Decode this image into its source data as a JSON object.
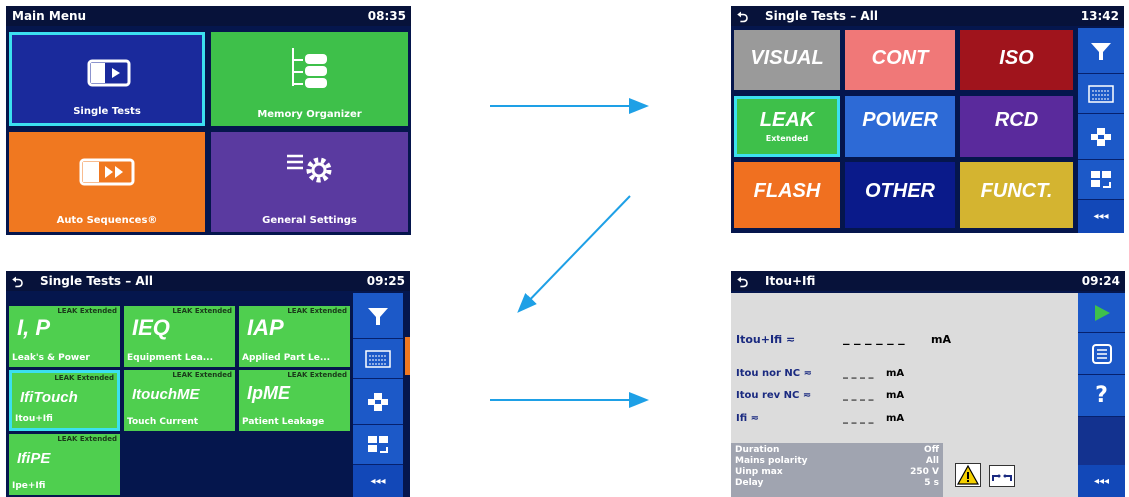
{
  "screen1": {
    "title": "Main Menu",
    "time": "08:35",
    "tiles": [
      {
        "label": "Single Tests",
        "color": "#1a2a9c",
        "icon": "single-tests-icon"
      },
      {
        "label": "Memory Organizer",
        "color": "#3ec04a",
        "icon": "memory-tree-icon"
      },
      {
        "label": "Auto Sequences®",
        "color": "#f07820",
        "icon": "auto-sequence-icon"
      },
      {
        "label": "General Settings",
        "color": "#5a3aa0",
        "icon": "settings-gear-icon"
      }
    ]
  },
  "screen2": {
    "title": "Single Tests – All",
    "time": "13:42",
    "tiles": [
      {
        "label": "VISUAL",
        "sub": "",
        "color": "#9a9a9a"
      },
      {
        "label": "CONT",
        "sub": "",
        "color": "#f07878"
      },
      {
        "label": "ISO",
        "sub": "",
        "color": "#a0141c"
      },
      {
        "label": "LEAK",
        "sub": "Extended",
        "color": "#3ec04a"
      },
      {
        "label": "POWER",
        "sub": "",
        "color": "#2d6ad6"
      },
      {
        "label": "RCD",
        "sub": "",
        "color": "#5a2a9c"
      },
      {
        "label": "FLASH",
        "sub": "",
        "color": "#f07020"
      },
      {
        "label": "OTHER",
        "sub": "",
        "color": "#0a1a8a"
      },
      {
        "label": "FUNCT.",
        "sub": "",
        "color": "#d4b430"
      }
    ],
    "sidebar": [
      "filter-icon",
      "keyboard-icon",
      "move-icon",
      "swap-icon",
      "◂◂◂"
    ]
  },
  "screen3": {
    "title": "Single Tests – All",
    "time": "09:25",
    "tiles": [
      {
        "top": "LEAK Extended",
        "symbol": "I, P",
        "sub": "Leak's & Power"
      },
      {
        "top": "LEAK Extended",
        "symbol": "IEQ",
        "sub": "Equipment Lea..."
      },
      {
        "top": "LEAK Extended",
        "symbol": "IAP",
        "sub": "Applied Part Le..."
      },
      {
        "top": "LEAK Extended",
        "symbol": "IfiTouch",
        "sub": "Itou+Ifi"
      },
      {
        "top": "LEAK Extended",
        "symbol": "ItouchME",
        "sub": "Touch Current"
      },
      {
        "top": "LEAK Extended",
        "symbol": "IpME",
        "sub": "Patient Leakage"
      },
      {
        "top": "LEAK Extended",
        "symbol": "IfiPE",
        "sub": "Ipe+Ifi"
      }
    ],
    "sidebar_more": "◂◂◂"
  },
  "screen4": {
    "title": "Itou+Ifi",
    "time": "09:24",
    "results": [
      {
        "label": "Itou+Ifi ≂",
        "value": "_ _ _ _ _ _",
        "unit": "mA"
      },
      {
        "label": "Itou nor NC ≂",
        "value": "_ _ _ _",
        "unit": "mA"
      },
      {
        "label": "Itou rev NC ≂",
        "value": "_ _ _ _",
        "unit": "mA"
      },
      {
        "label": "Ifi ≂",
        "value": "_ _ _ _",
        "unit": "mA"
      }
    ],
    "params": [
      {
        "name": "Duration",
        "value": "Off"
      },
      {
        "name": "Mains polarity",
        "value": "All"
      },
      {
        "name": "Uinp max",
        "value": "250 V"
      },
      {
        "name": "Delay",
        "value": "5 s"
      }
    ],
    "sidebar": {
      "help": "?",
      "more": "◂◂◂"
    }
  },
  "colors": {
    "accent": "#3ce0f0",
    "arrow": "#1ea0e6",
    "leak_green": "#4fcf4f"
  }
}
